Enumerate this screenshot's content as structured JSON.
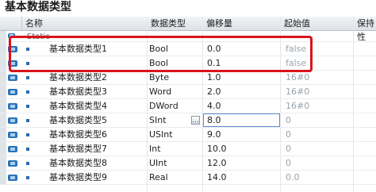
{
  "title": "基本数据类型",
  "columns": {
    "name": "名称",
    "data_type": "数据类型",
    "offset": "偏移量",
    "start_value": "起始值",
    "retain": "保持性"
  },
  "static_label": "Static",
  "rows": [
    {
      "name": "基本数据类型1",
      "data_type": "Bool",
      "offset": "0.0",
      "start_value": "false"
    },
    {
      "name": "",
      "data_type": "Bool",
      "offset": "0.1",
      "start_value": "false"
    },
    {
      "name": "基本数据类型2",
      "data_type": "Byte",
      "offset": "1.0",
      "start_value": "16#0"
    },
    {
      "name": "基本数据类型3",
      "data_type": "Word",
      "offset": "2.0",
      "start_value": "16#0"
    },
    {
      "name": "基本数据类型4",
      "data_type": "DWord",
      "offset": "4.0",
      "start_value": "16#0"
    },
    {
      "name": "基本数据类型5",
      "data_type": "SInt",
      "offset": "8.0",
      "start_value": "0"
    },
    {
      "name": "基本数据类型6",
      "data_type": "USInt",
      "offset": "9.0",
      "start_value": "0"
    },
    {
      "name": "基本数据类型7",
      "data_type": "Int",
      "offset": "10.0",
      "start_value": "0"
    },
    {
      "name": "基本数据类型8",
      "data_type": "UInt",
      "offset": "12.0",
      "start_value": "0"
    },
    {
      "name": "基本数据类型9",
      "data_type": "Real",
      "offset": "14.0",
      "start_value": "0.0"
    }
  ],
  "editing_row": 5,
  "highlight_color": "#d8141c",
  "icons": {
    "io": "interface-member-icon",
    "bullet": "element-bullet-icon",
    "edit_button": "ellipsis-button-icon"
  }
}
